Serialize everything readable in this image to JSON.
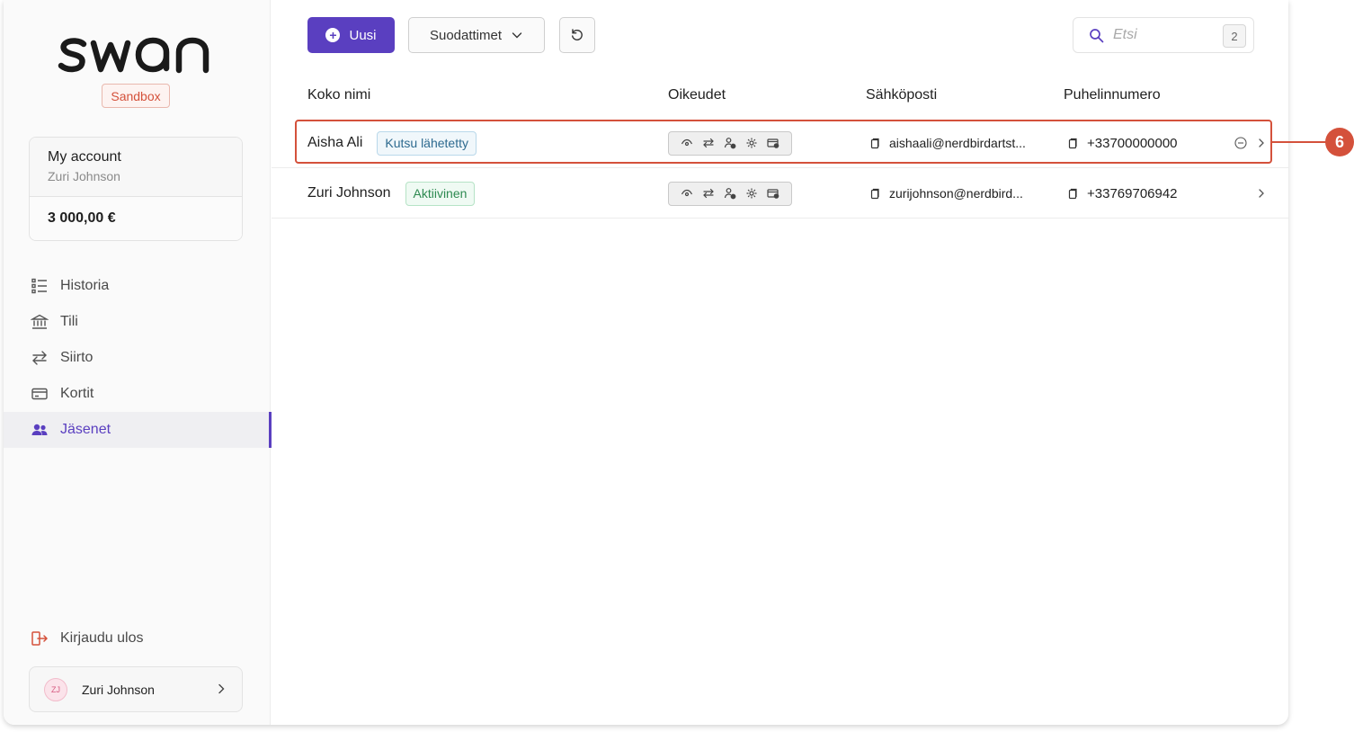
{
  "brand": {
    "logo_text": "swan",
    "env_badge": "Sandbox",
    "accent": "#5a3fc0",
    "annotation_color": "#d4513b"
  },
  "account": {
    "title": "My account",
    "holder": "Zuri Johnson",
    "balance": "3 000,00 €"
  },
  "nav": [
    {
      "label": "Historia",
      "icon": "list-icon",
      "active": false
    },
    {
      "label": "Tili",
      "icon": "bank-icon",
      "active": false
    },
    {
      "label": "Siirto",
      "icon": "transfer-icon",
      "active": false
    },
    {
      "label": "Kortit",
      "icon": "card-icon",
      "active": false
    },
    {
      "label": "Jäsenet",
      "icon": "members-icon",
      "active": true
    }
  ],
  "logout_label": "Kirjaudu ulos",
  "current_user": {
    "initials": "ZJ",
    "name": "Zuri Johnson"
  },
  "toolbar": {
    "new_label": "Uusi",
    "filters_label": "Suodattimet",
    "search_placeholder": "Etsi",
    "search_shortcut": "2"
  },
  "table": {
    "columns": [
      "Koko nimi",
      "Oikeudet",
      "Sähköposti",
      "Puhelinnumero"
    ],
    "rows": [
      {
        "name": "Aisha Ali",
        "status": "Kutsu lähetetty",
        "status_type": "invited",
        "email": "aishaali@nerdbirdartst...",
        "phone": "+33700000000",
        "has_remove": true
      },
      {
        "name": "Zuri Johnson",
        "status": "Aktiivinen",
        "status_type": "active",
        "email": "zurijohnson@nerdbird...",
        "phone": "+33769706942",
        "has_remove": false
      }
    ]
  },
  "callout_number": "6"
}
